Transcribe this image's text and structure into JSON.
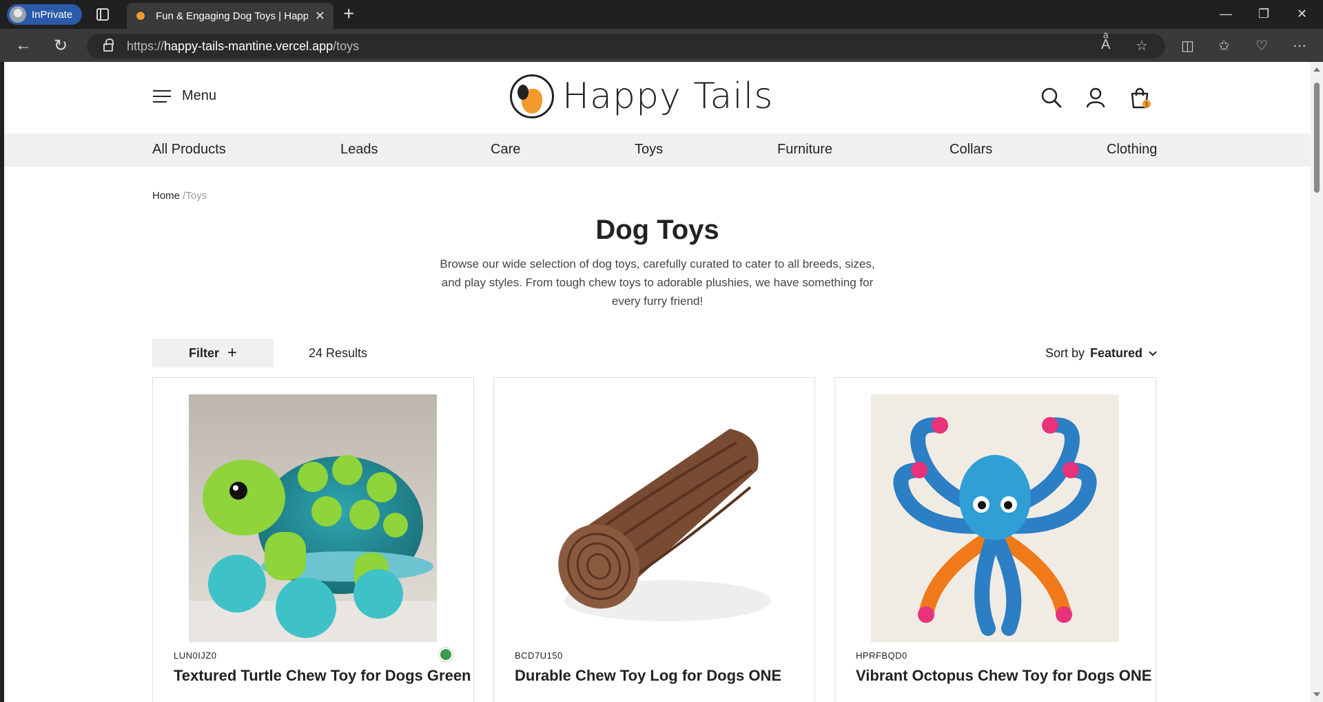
{
  "browser": {
    "inprivate_label": "InPrivate",
    "tab_title": "Fun & Engaging Dog Toys | Happy Tails",
    "url_scheme": "https://",
    "url_host": "happy-tails-mantine.vercel.app",
    "url_path": "/toys"
  },
  "header": {
    "menu_label": "Menu",
    "logo_text": "Happy Tails",
    "cart_count": "1"
  },
  "nav": {
    "items": [
      "All Products",
      "Leads",
      "Care",
      "Toys",
      "Furniture",
      "Collars",
      "Clothing"
    ]
  },
  "breadcrumb": {
    "home": "Home",
    "separator": "/",
    "current": "Toys"
  },
  "page": {
    "title": "Dog Toys",
    "description": "Browse our wide selection of dog toys, carefully curated to cater to all breeds, sizes, and play styles. From tough chew toys to adorable plushies, we have something for every furry friend!"
  },
  "toolbar": {
    "filter_label": "Filter",
    "results_label": "24 Results",
    "sort_prefix": "Sort by",
    "sort_value": "Featured"
  },
  "products": [
    {
      "sku": "LUN0IJZ0",
      "name": "Textured Turtle Chew Toy for Dogs Green",
      "swatch_color": "#3d9a4f"
    },
    {
      "sku": "BCD7U150",
      "name": "Durable Chew Toy Log for Dogs ONE",
      "swatch_color": ""
    },
    {
      "sku": "HPRFBQD0",
      "name": "Vibrant Octopus Chew Toy for Dogs ONE",
      "swatch_color": ""
    }
  ]
}
